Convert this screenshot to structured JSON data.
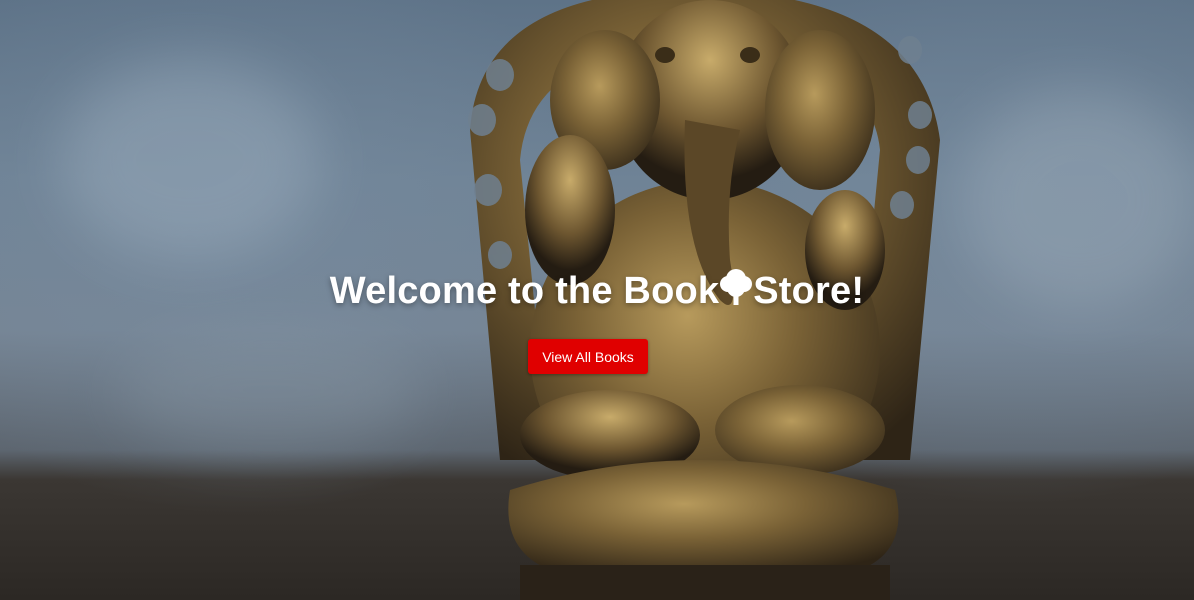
{
  "hero": {
    "title_before": "Welcome to the Book",
    "title_after": "Store!",
    "title_icon": "tree-icon",
    "cta_label": "View All Books",
    "cta_color": "#e00000"
  }
}
